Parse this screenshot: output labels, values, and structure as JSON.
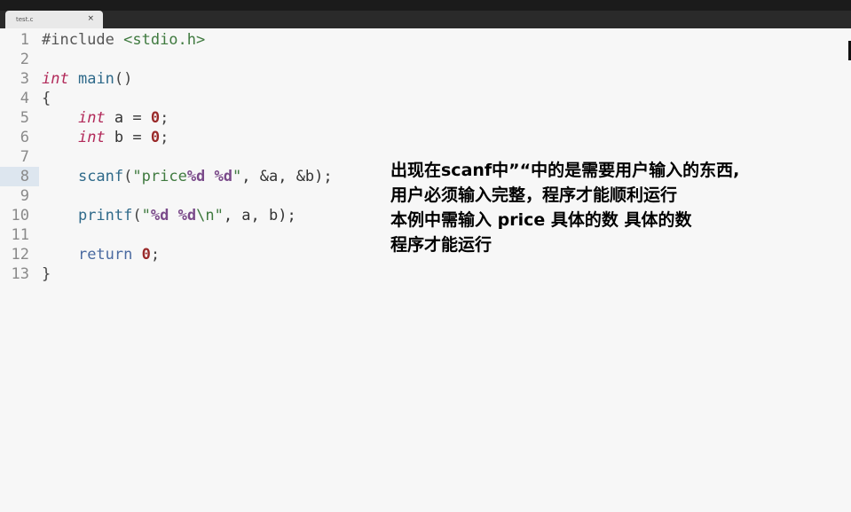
{
  "tab": {
    "title": "test.c",
    "close_glyph": "×"
  },
  "code_lines": [
    {
      "num": "1",
      "tokens": [
        {
          "t": "#include ",
          "c": "kw-pp"
        },
        {
          "t": "<stdio.h>",
          "c": "str"
        }
      ]
    },
    {
      "num": "2",
      "tokens": []
    },
    {
      "num": "3",
      "tokens": [
        {
          "t": "int",
          "c": "kw-type"
        },
        {
          "t": " ",
          "c": ""
        },
        {
          "t": "main",
          "c": "fn"
        },
        {
          "t": "()",
          "c": "punct"
        }
      ]
    },
    {
      "num": "4",
      "tokens": [
        {
          "t": "{",
          "c": "punct"
        }
      ]
    },
    {
      "num": "5",
      "tokens": [
        {
          "t": "    ",
          "c": ""
        },
        {
          "t": "int",
          "c": "kw-type"
        },
        {
          "t": " a = ",
          "c": ""
        },
        {
          "t": "0",
          "c": "num"
        },
        {
          "t": ";",
          "c": "punct"
        }
      ]
    },
    {
      "num": "6",
      "tokens": [
        {
          "t": "    ",
          "c": ""
        },
        {
          "t": "int",
          "c": "kw-type"
        },
        {
          "t": " b = ",
          "c": ""
        },
        {
          "t": "0",
          "c": "num"
        },
        {
          "t": ";",
          "c": "punct"
        }
      ]
    },
    {
      "num": "7",
      "tokens": []
    },
    {
      "num": "8",
      "current": true,
      "tokens": [
        {
          "t": "    ",
          "c": ""
        },
        {
          "t": "scanf",
          "c": "fn"
        },
        {
          "t": "(",
          "c": "punct"
        },
        {
          "t": "\"price",
          "c": "str"
        },
        {
          "t": "%d",
          "c": "fmt"
        },
        {
          "t": " ",
          "c": "str"
        },
        {
          "t": "%d",
          "c": "fmt"
        },
        {
          "t": "\"",
          "c": "str"
        },
        {
          "t": ", &a, &b);",
          "c": ""
        }
      ]
    },
    {
      "num": "9",
      "tokens": []
    },
    {
      "num": "10",
      "tokens": [
        {
          "t": "    ",
          "c": ""
        },
        {
          "t": "printf",
          "c": "fn"
        },
        {
          "t": "(",
          "c": "punct"
        },
        {
          "t": "\"",
          "c": "str"
        },
        {
          "t": "%d",
          "c": "fmt"
        },
        {
          "t": " ",
          "c": "str"
        },
        {
          "t": "%d",
          "c": "fmt"
        },
        {
          "t": "\\n\"",
          "c": "str"
        },
        {
          "t": ", a, b);",
          "c": ""
        }
      ]
    },
    {
      "num": "11",
      "tokens": []
    },
    {
      "num": "12",
      "tokens": [
        {
          "t": "    ",
          "c": ""
        },
        {
          "t": "return",
          "c": "kw"
        },
        {
          "t": " ",
          "c": ""
        },
        {
          "t": "0",
          "c": "num"
        },
        {
          "t": ";",
          "c": "punct"
        }
      ]
    },
    {
      "num": "13",
      "tokens": [
        {
          "t": "}",
          "c": "punct"
        }
      ]
    }
  ],
  "annotation": {
    "lines": [
      "出现在scanf中”“中的是需要用户输入的东西,",
      "用户必须输入完整，程序才能顺利运行",
      "本例中需输入 price 具体的数 具体的数",
      "程序才能运行"
    ]
  }
}
